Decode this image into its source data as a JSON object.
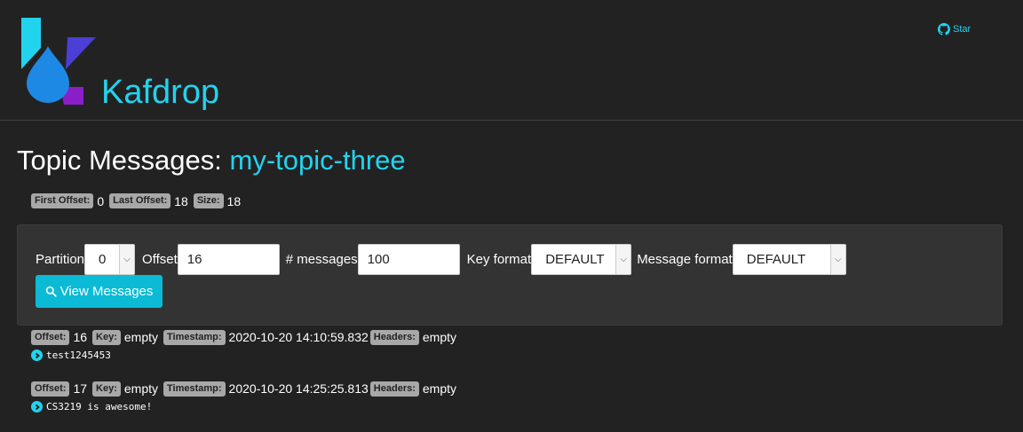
{
  "app": {
    "brand": "Kafdrop",
    "star_label": "Star",
    "colors": {
      "accent": "#22d3ee",
      "background": "#222222",
      "panel": "#333333",
      "button": "#0bbbd6"
    }
  },
  "page": {
    "title_prefix": "Topic Messages:",
    "topic_name": "my-topic-three"
  },
  "offsets": {
    "first_label": "First Offset:",
    "first_value": "0",
    "last_label": "Last Offset:",
    "last_value": "18",
    "size_label": "Size:",
    "size_value": "18"
  },
  "form": {
    "partition_label": "Partition",
    "partition_value": "0",
    "offset_label": "Offset",
    "offset_value": "16",
    "messages_label": "# messages",
    "messages_value": "100",
    "key_format_label": "Key format",
    "key_format_value": "DEFAULT",
    "message_format_label": "Message format",
    "message_format_value": "DEFAULT",
    "view_button_label": "View Messages"
  },
  "messages": [
    {
      "offset_label": "Offset:",
      "offset": "16",
      "key_label": "Key:",
      "key": "empty",
      "timestamp_label": "Timestamp:",
      "timestamp": "2020-10-20 14:10:59.832",
      "headers_label": "Headers:",
      "headers": "empty",
      "body": "test1245453"
    },
    {
      "offset_label": "Offset:",
      "offset": "17",
      "key_label": "Key:",
      "key": "empty",
      "timestamp_label": "Timestamp:",
      "timestamp": "2020-10-20 14:25:25.813",
      "headers_label": "Headers:",
      "headers": "empty",
      "body": "CS3219 is awesome!"
    }
  ]
}
